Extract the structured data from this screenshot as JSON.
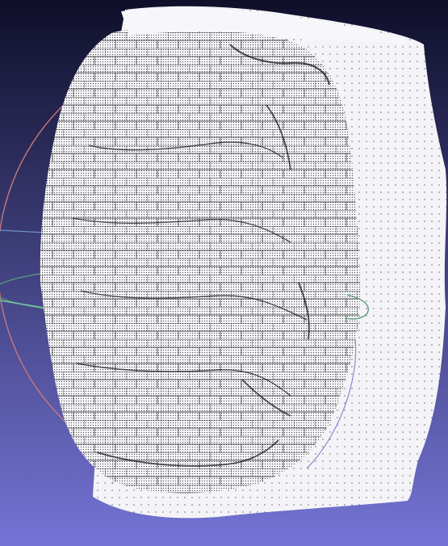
{
  "viewport": {
    "background_top": "#0f0f2a",
    "background_bottom": "#7474d6",
    "mesh_fill": "#f4f4f8",
    "mesh_dots": "#1a1a1a",
    "trackball_colors": {
      "x_ring": "#c47a7a",
      "y_ring": "#5a9a7a",
      "z_ring": "#8a8ad0",
      "axis_line": "#6fc8a0"
    }
  },
  "icons": {
    "trackball": "trackball-gizmo-icon"
  }
}
